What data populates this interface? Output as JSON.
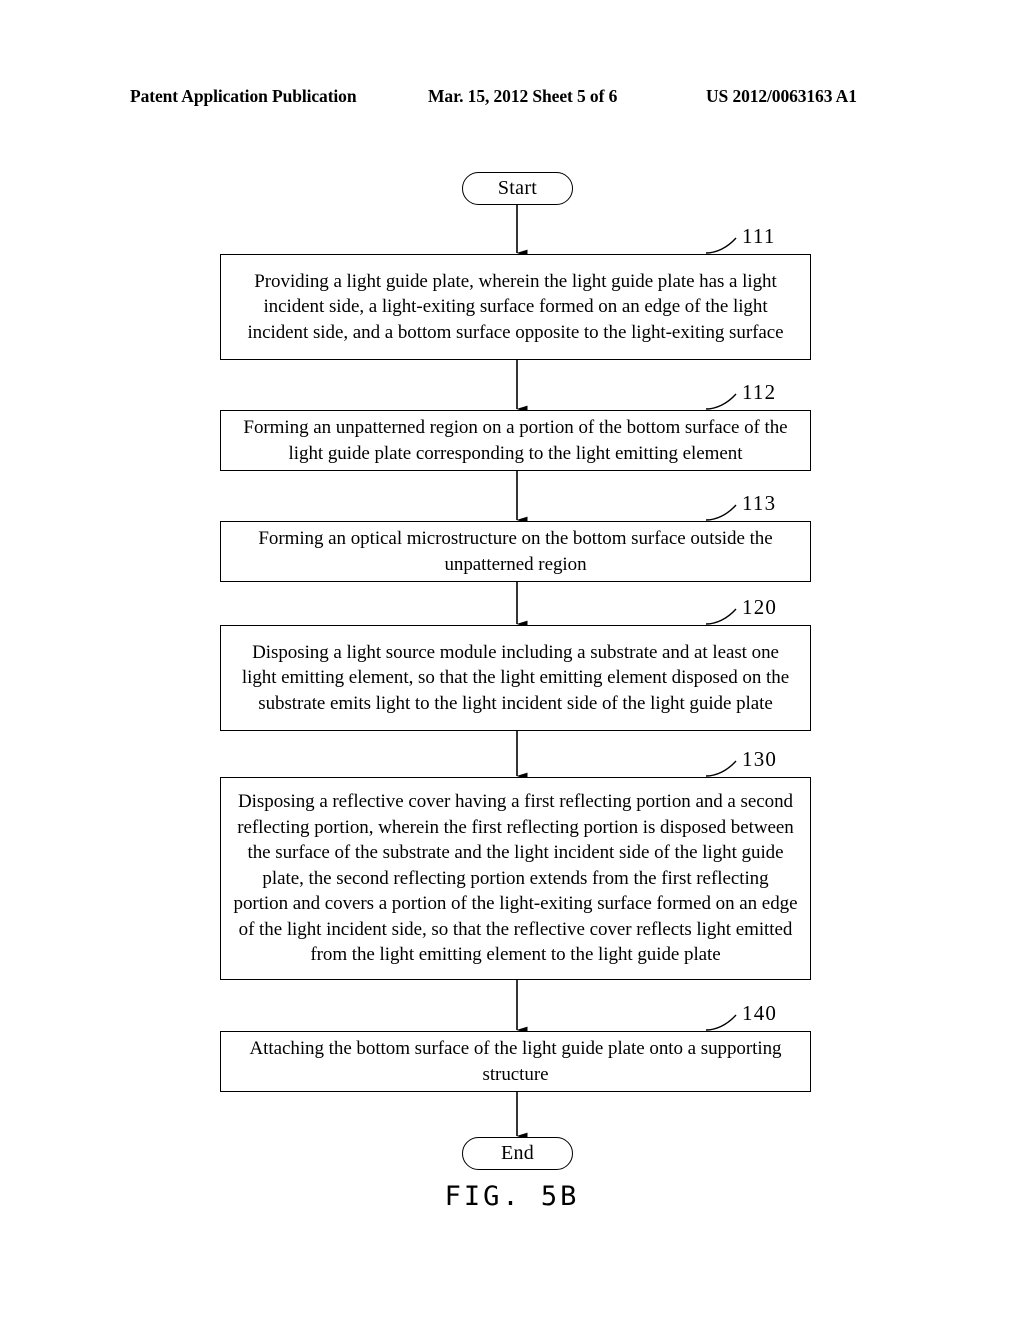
{
  "header": {
    "left": "Patent Application Publication",
    "middle": "Mar. 15, 2012  Sheet 5 of 6",
    "right": "US 2012/0063163 A1"
  },
  "figure": {
    "caption": "FIG.  5B"
  },
  "flowchart": {
    "start_label": "Start",
    "end_label": "End",
    "steps": [
      {
        "ref": "111",
        "text": "Providing a light guide plate, wherein the light guide plate has a light incident side, a light-exiting surface formed on an edge of the light incident side, and a bottom surface opposite to the light-exiting surface"
      },
      {
        "ref": "112",
        "text": "Forming an unpatterned region on a portion of the bottom surface of the light guide plate corresponding to the light emitting element"
      },
      {
        "ref": "113",
        "text": "Forming an optical microstructure on the bottom surface outside the unpatterned region"
      },
      {
        "ref": "120",
        "text": "Disposing a light source module including a substrate and at least one light emitting element, so that the light emitting element disposed on the substrate emits light to the light incident side of the light guide plate"
      },
      {
        "ref": "130",
        "text": "Disposing a reflective cover having a first reflecting portion and a second reflecting portion, wherein the first reflecting portion is disposed between the surface of the substrate and the light incident side of the light guide plate, the second reflecting portion extends from the first reflecting portion and covers a portion of the light-exiting surface formed on an edge of the light incident side, so that the reflective cover reflects light emitted from the light emitting element to the light guide plate"
      },
      {
        "ref": "140",
        "text": "Attaching the bottom surface of the light guide plate onto a supporting structure"
      }
    ]
  }
}
